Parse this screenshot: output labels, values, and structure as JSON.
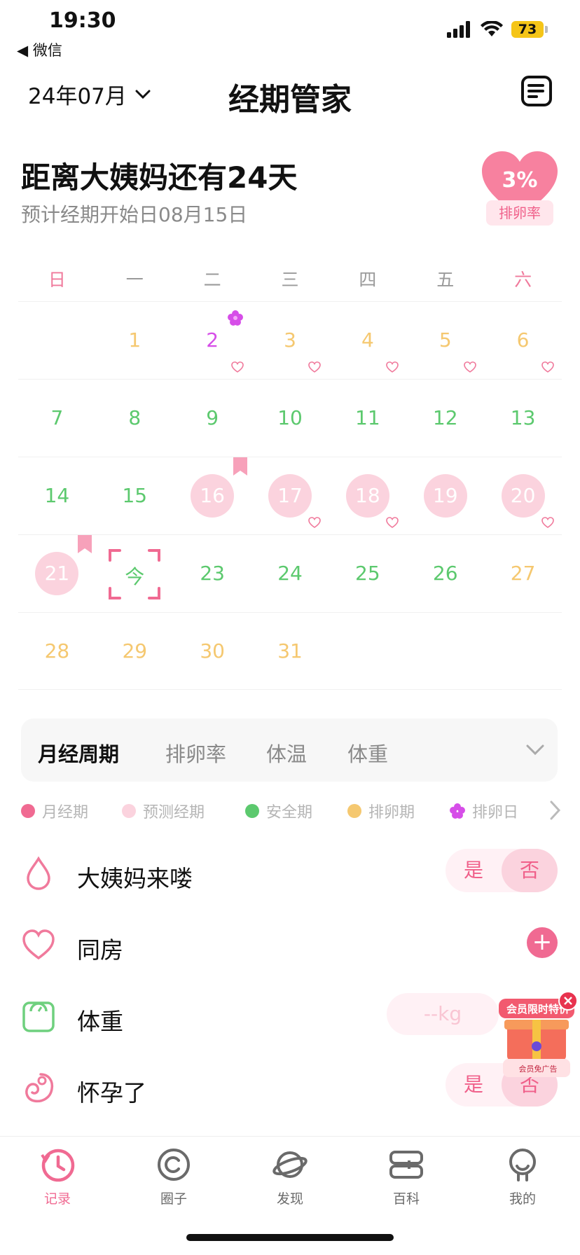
{
  "status_bar": {
    "time": "19:30",
    "back_app": "◀ 微信",
    "battery": "73"
  },
  "header": {
    "month": "24年07月",
    "title": "经期管家"
  },
  "countdown": {
    "title": "距离大姨妈还有24天",
    "subtitle": "预计经期开始日08月15日",
    "ovulation_rate": "3%",
    "ovulation_label": "排卵率"
  },
  "calendar": {
    "weekdays": [
      "日",
      "一",
      "二",
      "三",
      "四",
      "五",
      "六"
    ],
    "today_label": "今",
    "days": {
      "d1": "1",
      "d2": "2",
      "d3": "3",
      "d4": "4",
      "d5": "5",
      "d6": "6",
      "d7": "7",
      "d8": "8",
      "d9": "9",
      "d10": "10",
      "d11": "11",
      "d12": "12",
      "d13": "13",
      "d14": "14",
      "d15": "15",
      "d16": "16",
      "d17": "17",
      "d18": "18",
      "d19": "19",
      "d20": "20",
      "d21": "21",
      "d23": "23",
      "d24": "24",
      "d25": "25",
      "d26": "26",
      "d27": "27",
      "d28": "28",
      "d29": "29",
      "d30": "30",
      "d31": "31"
    }
  },
  "tabs": {
    "cycle": "月经周期",
    "ovulation": "排卵率",
    "temperature": "体温",
    "weight": "体重"
  },
  "legend": {
    "period": "月经期",
    "predicted": "预测经期",
    "safe": "安全期",
    "ovulation_phase": "排卵期",
    "ovulation_day": "排卵日"
  },
  "records": {
    "period_came": "大姨妈来喽",
    "intimacy": "同房",
    "weight": "体重",
    "weight_placeholder": "--kg",
    "pregnant": "怀孕了",
    "yes": "是",
    "no": "否"
  },
  "promo": {
    "title": "会员限时特价",
    "subtitle": "会员免广告"
  },
  "nav": {
    "record": "记录",
    "circle": "圈子",
    "discover": "发现",
    "wiki": "百科",
    "mine": "我的"
  },
  "colors": {
    "accent_pink": "#f06a92",
    "predicted_pink": "#fbd3de",
    "safe_green": "#5cc96e",
    "ovulation_yellow": "#f5c870",
    "ovulation_day_violet": "#d64ee8"
  }
}
